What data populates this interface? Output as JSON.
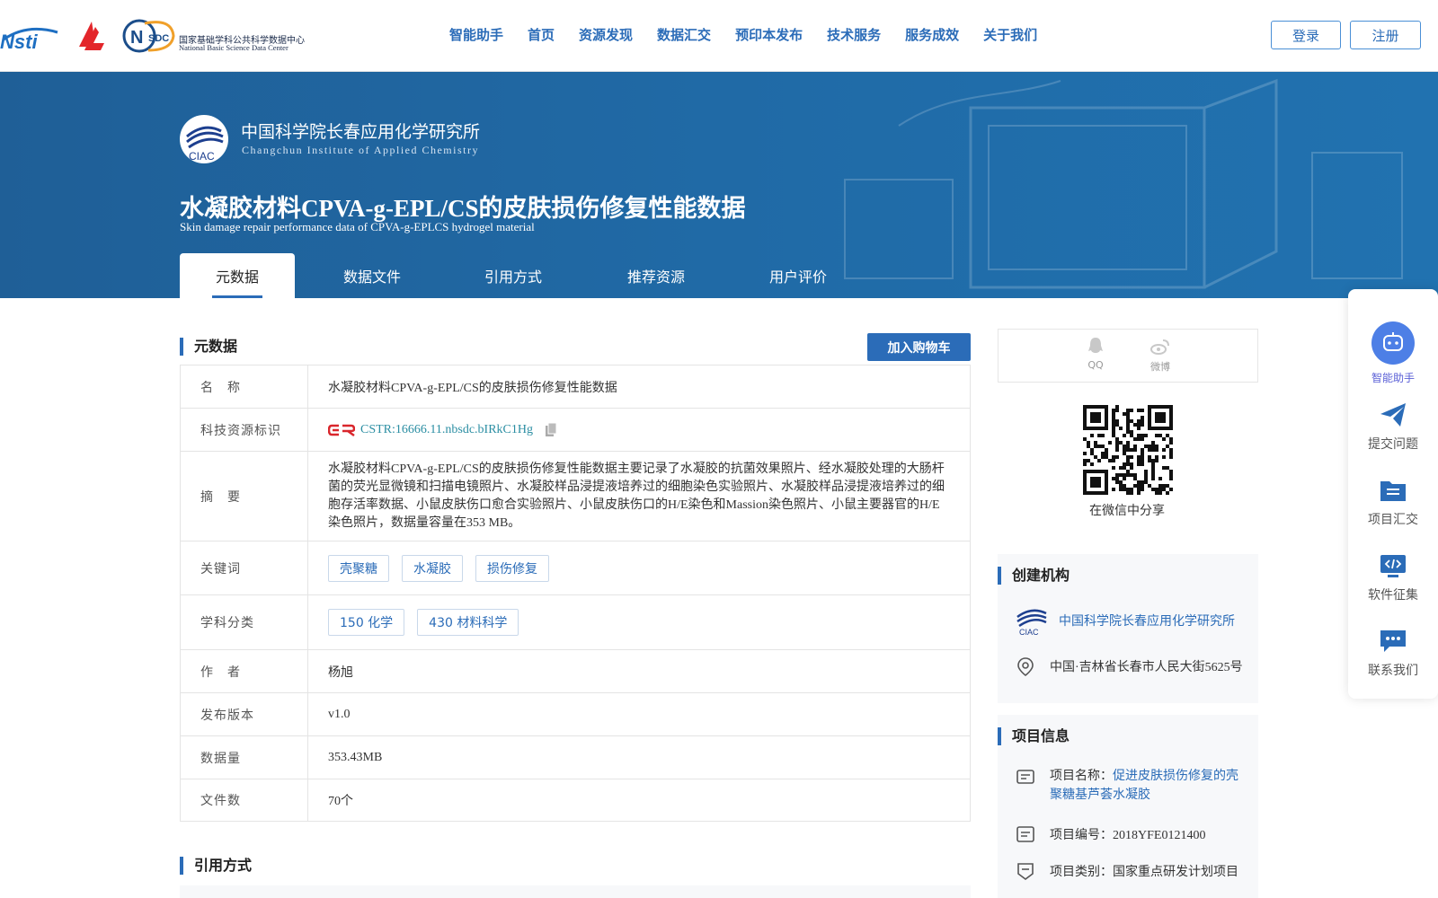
{
  "nav": {
    "items": [
      "智能助手",
      "首页",
      "资源发现",
      "数据汇交",
      "预印本发布",
      "技术服务",
      "服务成效",
      "关于我们"
    ],
    "login": "登录",
    "register": "注册"
  },
  "logos": {
    "nsdc_cn": "国家基础学科公共科学数据中心",
    "nsdc_en": "National Basic Science Data Center"
  },
  "banner": {
    "institute_cn": "中国科学院长春应用化学研究所",
    "institute_en": "Changchun Institute of Applied Chemistry",
    "title_cn": "水凝胶材料CPVA-g-EPL/CS的皮肤损伤修复性能数据",
    "title_en": "Skin damage repair performance data of CPVA-g-EPLCS hydrogel material",
    "tabs": [
      "元数据",
      "数据文件",
      "引用方式",
      "推荐资源",
      "用户评价"
    ]
  },
  "metadata": {
    "heading": "元数据",
    "cart_button": "加入购物车",
    "name_label": "名　称",
    "name": "水凝胶材料CPVA-g-EPL/CS的皮肤损伤修复性能数据",
    "cstr_label": "科技资源标识",
    "cstr": "CSTR:16666.11.nbsdc.bIRkC1Hg",
    "abstract_label": "摘　要",
    "abstract": "水凝胶材料CPVA-g-EPL/CS的皮肤损伤修复性能数据主要记录了水凝胶的抗菌效果照片、经水凝胶处理的大肠杆菌的荧光显微镜和扫描电镜照片、水凝胶样品浸提液培养过的细胞染色实验照片、水凝胶样品浸提液培养过的细胞存活率数据、小鼠皮肤伤口愈合实验照片、小鼠皮肤伤口的H/E染色和Massion染色照片、小鼠主要器官的H/E染色照片，数据量容量在353 MB。",
    "keywords_label": "关键词",
    "keywords": [
      "壳聚糖",
      "水凝胶",
      "损伤修复"
    ],
    "subject_label": "学科分类",
    "subjects": [
      "150 化学",
      "430 材料科学"
    ],
    "author_label": "作　者",
    "author": "杨旭",
    "version_label": "发布版本",
    "version": "v1.0",
    "size_label": "数据量",
    "size": "353.43MB",
    "files_label": "文件数",
    "files": "70个"
  },
  "citation": {
    "heading": "引用方式"
  },
  "share": {
    "qq": "QQ",
    "weibo": "微博",
    "wechat": "在微信中分享"
  },
  "creator": {
    "heading": "创建机构",
    "name": "中国科学院长春应用化学研究所",
    "address": "中国·吉林省长春市人民大街5625号"
  },
  "project": {
    "heading": "项目信息",
    "name_label": "项目名称：",
    "name_line1": "促进皮肤损伤修复的壳",
    "name_line2": "聚糖基芦荟水凝胶",
    "code": "项目编号：2018YFE0121400",
    "category": "项目类别：国家重点研发计划项目"
  },
  "sidebar": [
    "智能助手",
    "提交问题",
    "项目汇交",
    "软件征集",
    "联系我们"
  ],
  "colors": {
    "primary": "#2b6cb8",
    "banner": "#206aa6",
    "link": "#2b8ea3"
  }
}
